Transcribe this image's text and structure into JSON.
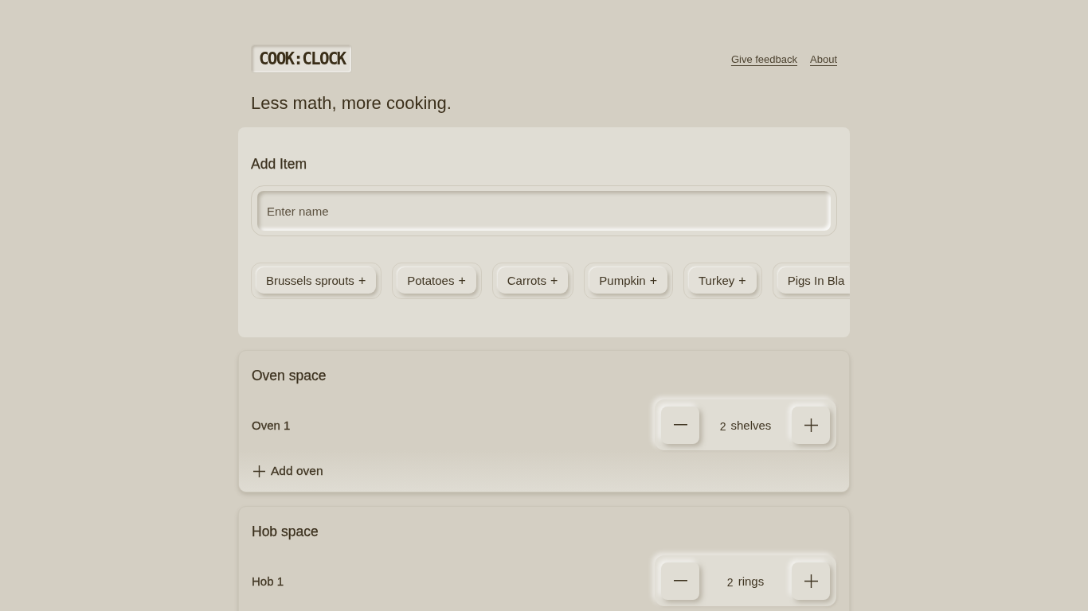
{
  "header": {
    "logo": "COOK:CLOCK",
    "links": [
      "Give feedback",
      "About"
    ]
  },
  "tagline": "Less math, more cooking.",
  "add_item": {
    "title": "Add Item",
    "name_field": {
      "placeholder": "Enter name"
    },
    "suggestions": [
      {
        "label": "Brussels sprouts",
        "plus": "+"
      },
      {
        "label": "Potatoes",
        "plus": "+"
      },
      {
        "label": "Carrots",
        "plus": "+"
      },
      {
        "label": "Pumpkin",
        "plus": "+"
      },
      {
        "label": "Turkey",
        "plus": "+"
      },
      {
        "label": "Pigs In Bla"
      }
    ]
  },
  "spaces": [
    {
      "title": "Oven space",
      "appliances": [
        {
          "name": "Oven 1",
          "count": "2",
          "unit": "shelves"
        }
      ],
      "add_button": "Add oven"
    },
    {
      "title": "Hob space",
      "appliances": [
        {
          "name": "Hob 1",
          "count": "2",
          "unit": "rings"
        }
      ]
    }
  ]
}
